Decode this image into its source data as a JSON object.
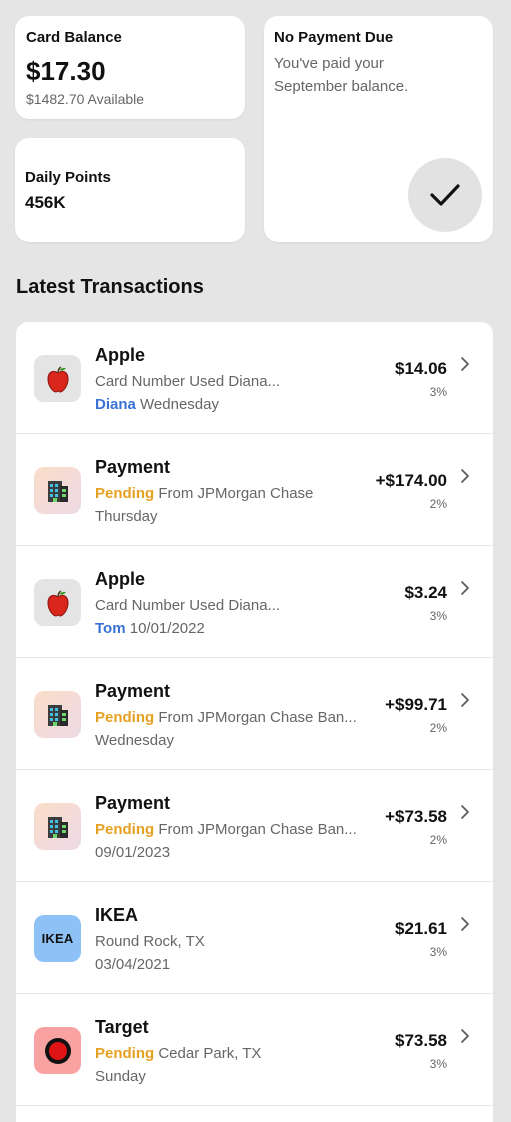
{
  "balance": {
    "title": "Card Balance",
    "amount": "$17.30",
    "available": "$1482.70 Available"
  },
  "points": {
    "title": "Daily Points",
    "value": "456K"
  },
  "payment_due": {
    "title": "No Payment Due",
    "message": "You've paid your September balance.",
    "icon": "checkmark-icon"
  },
  "section_title": "Latest Transactions",
  "accent_colors": {
    "pending": "#e5a021",
    "user": "#3a72d4"
  },
  "transactions": [
    {
      "name": "Apple",
      "icon": "apple-icon",
      "prefix": "",
      "detail": "Card Number Used Diana...",
      "user": "Diana",
      "date": "Wednesday",
      "amount": "$14.06",
      "percent": "3%"
    },
    {
      "name": "Payment",
      "icon": "building-icon",
      "prefix": "Pending",
      "detail": "From JPMorgan Chase",
      "user": "",
      "date": "Thursday",
      "amount": "+$174.00",
      "percent": "2%"
    },
    {
      "name": "Apple",
      "icon": "apple-icon",
      "prefix": "",
      "detail": "Card Number Used Diana...",
      "user": "Tom",
      "date": "10/01/2022",
      "amount": "$3.24",
      "percent": "3%"
    },
    {
      "name": "Payment",
      "icon": "building-icon",
      "prefix": "Pending",
      "detail": "From JPMorgan Chase Ban...",
      "user": "",
      "date": "Wednesday",
      "amount": "+$99.71",
      "percent": "2%"
    },
    {
      "name": "Payment",
      "icon": "building-icon",
      "prefix": "Pending",
      "detail": "From JPMorgan Chase Ban...",
      "user": "",
      "date": "09/01/2023",
      "amount": "+$73.58",
      "percent": "2%"
    },
    {
      "name": "IKEA",
      "icon": "ikea-logo",
      "logo_text": "IKEA",
      "prefix": "",
      "detail": "Round Rock, TX",
      "user": "",
      "date": "03/04/2021",
      "amount": "$21.61",
      "percent": "3%"
    },
    {
      "name": "Target",
      "icon": "target-logo",
      "prefix": "Pending",
      "detail": "Cedar Park, TX",
      "user": "",
      "date": "Sunday",
      "amount": "$73.58",
      "percent": "3%"
    }
  ]
}
